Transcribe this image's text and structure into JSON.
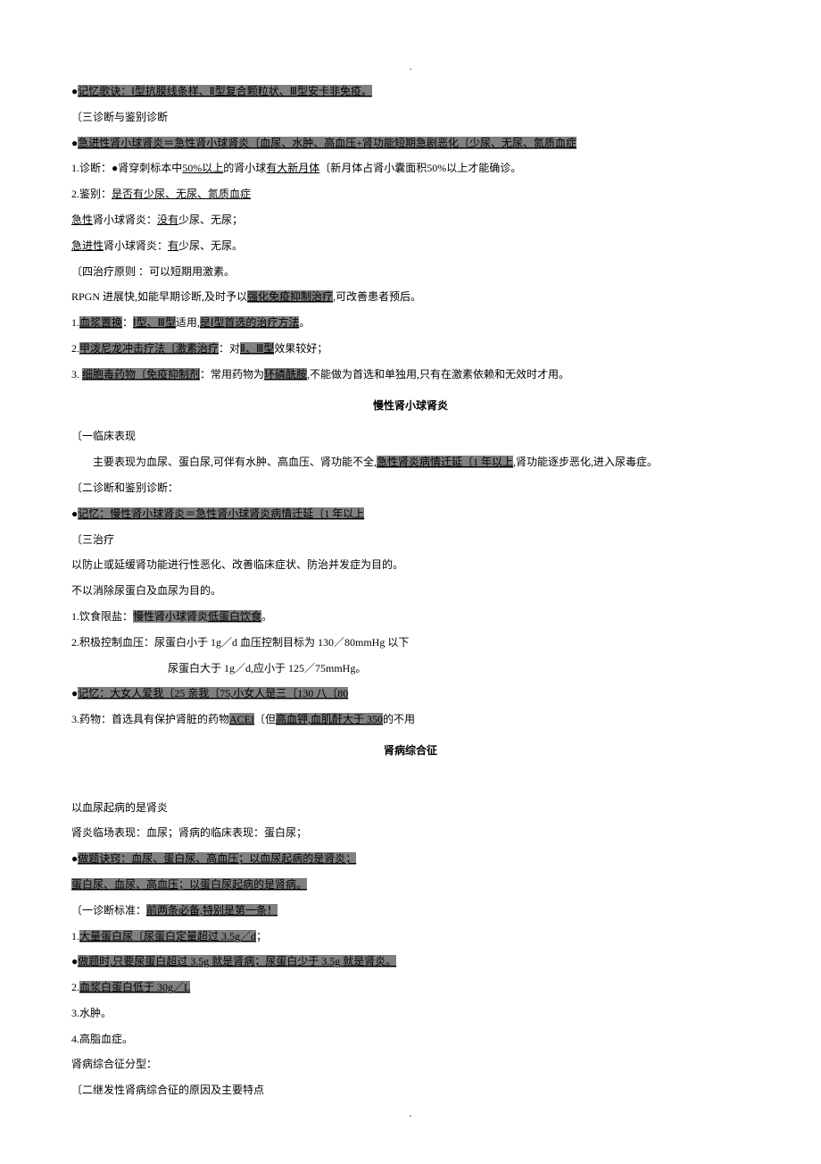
{
  "topdot": ".",
  "l1_bullet": "●",
  "l1_text": "记忆歌诀：Ⅰ型抗膜线条样、Ⅱ型复合颗粒状、Ⅲ型安卡非免疫。",
  "l2": "〔三诊断与鉴别诊断",
  "l3_bullet": "●",
  "l3_text": "急进性肾小球肾炎＝急性肾小球肾炎〔血尿、水肿、高血压+肾功能短期急剧恶化〔少尿、无尿、氮质血症",
  "l4_a": "1.诊断：●肾穿刺标本中",
  "l4_b": "50%以上",
  "l4_c": "的肾小球",
  "l4_d": "有大新月体",
  "l4_e": "〔新月体占肾小囊面积50%以上才能确诊。",
  "l5_a": "2.鉴别：",
  "l5_b": "是否有少尿、无尿、氮质血症",
  "l6_a": "急性",
  "l6_b": "肾小球肾炎：",
  "l6_c": "没有",
  "l6_d": "少尿、无尿；",
  "l7_a": "急进性",
  "l7_b": "肾小球肾炎：",
  "l7_c": "有",
  "l7_d": "少尿、无尿。",
  "l8": "〔四治疗原则 ：可以短期用激素。",
  "l9_a": "RPGN 进展快,如能早期诊断,及时予以",
  "l9_b": "强化免疫抑制治疗",
  "l9_c": ",可改善患者预后。",
  "l10_a": "1.",
  "l10_b": "血浆置换",
  "l10_c": "：",
  "l10_d": "Ⅰ型、Ⅲ型",
  "l10_e": "适用,",
  "l10_f": "是Ⅰ型首选的治疗方法",
  "l10_g": "。",
  "l11_a": "2.",
  "l11_b": "甲泼尼龙冲击疗法〔激素治疗",
  "l11_c": "：对",
  "l11_d": "Ⅱ、Ⅲ型",
  "l11_e": "效果较好；",
  "l12_a": "3. ",
  "l12_b": "细胞毒药物〔免疫抑制剂",
  "l12_c": "：常用药物为",
  "l12_d": "环磷酰胺",
  "l12_e": ",不能做为首选和单独用,只有在激素依赖和无效时才用。",
  "h1": "慢性肾小球肾炎",
  "l13": "〔一临床表现",
  "l14_a": "　　主要表现为血尿、蛋白尿,可伴有水肿、高血压、肾功能不全,",
  "l14_b": "急性肾炎病情迁延〔1 年以上",
  "l14_c": ",肾功能逐步恶化,进入尿毒症。",
  "l15": "〔二诊断和鉴别诊断：",
  "l16_bullet": "●",
  "l16_text": "记忆：慢性肾小球肾炎＝急性肾小球肾炎病情迁延〔1 年以上",
  "l17": "〔三治疗",
  "l18": "以防止或延缓肾功能进行性恶化、改善临床症状、防治并发症为目的。",
  "l19": "不以消除尿蛋白及血尿为目的。",
  "l20_a": "1.饮食限盐：",
  "l20_b": "慢性肾小球肾炎",
  "l20_c": "低蛋白饮食",
  "l20_d": "。",
  "l21": "2.积极控制血压：尿蛋白小于 1g／d 血压控制目标为 130／80mmHg 以下",
  "l22": "　　　　　　　　　尿蛋白大于 1g／d,应小于 125／75mmHg。",
  "l23_bullet": "●",
  "l23_text": "记忆：大女人爱我〔25 亲我〔75,小女人是三〔130 八〔80",
  "l24_a": "3.药物：首选具有保护肾脏的药物",
  "l24_b": "ACEI",
  "l24_c": "〔但",
  "l24_d": "高血钾,血肌酐大于 350",
  "l24_e": "的不用",
  "h2": "肾病综合征",
  "l25": "以血尿起病的是肾炎",
  "l26": "肾炎临场表现：血尿；肾病的临床表现：蛋白尿；",
  "l27_bullet": "●",
  "l27_text": "做题诀窍：血尿、蛋白尿、高血压；以血尿起病的是肾炎；",
  "l28": "蛋白尿、血尿、高血压；以蛋白尿起病的是肾病。",
  "l29_a": "〔一诊断标准：",
  "l29_b": "前两条必备,特别是第一条！",
  "l30_a": "1.",
  "l30_b": "大量蛋白尿〔尿蛋白定量超过 3.5g／d",
  "l30_c": "；",
  "l31_bullet": "●",
  "l31_text": "做题时,只要尿蛋白超过 3.5g 就是肾病；尿蛋白少于 3.5g 就是肾炎。",
  "l32_a": "2.",
  "l32_b": "血浆白蛋白低于 30g／L",
  "l33": "3.水肿。",
  "l34": "4.高脂血症。",
  "l35": "肾病综合征分型：",
  "l36": "〔二继发性肾病综合征的原因及主要特点",
  "botdot": "."
}
